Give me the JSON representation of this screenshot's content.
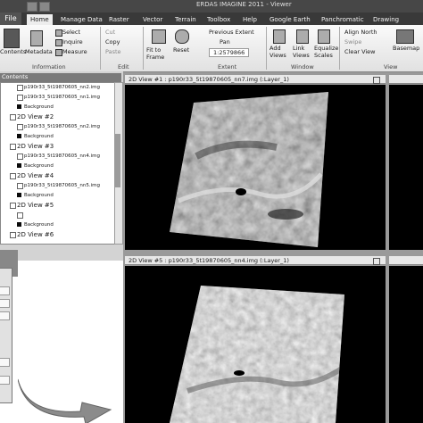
{
  "window": {
    "title": "ERDAS IMAGINE 2011 - Viewer"
  },
  "tabs": [
    "Home",
    "Manage Data",
    "Raster",
    "Vector",
    "Terrain",
    "Toolbox",
    "Help",
    "Google Earth",
    "Panchromatic",
    "Drawing"
  ],
  "file_tab": "File",
  "ribbon": {
    "contents": "Contents",
    "metadata": "Metadata",
    "select": "Select",
    "inquire": "Inquire",
    "measure": "Measure",
    "cut": "Cut",
    "copy": "Copy",
    "paste": "Paste",
    "fit_to_frame": "Fit to Frame",
    "reset": "Reset",
    "previous_extent": "Previous Extent",
    "pan": "Pan",
    "scale_value": "1:2579866",
    "add_views": "Add Views",
    "link_views": "Link Views",
    "equalize_scales": "Equalize Scales",
    "align_north": "Align North",
    "swipe": "Swipe",
    "clear_view": "Clear View",
    "basemap": "Basemap",
    "groups": {
      "information": "Information",
      "edit": "Edit",
      "extent": "Extent",
      "window": "Window",
      "view": "View"
    }
  },
  "contents_panel": {
    "title": "Contents",
    "items": [
      {
        "type": "layer",
        "label": "p190r33_5t19870605_nn2.img"
      },
      {
        "type": "layer",
        "label": "p190r33_5t19870605_nn1.img"
      },
      {
        "type": "bg",
        "label": "Background"
      },
      {
        "type": "view",
        "label": "2D View #2"
      },
      {
        "type": "layer",
        "label": "p190r33_5t19870605_nn2.img"
      },
      {
        "type": "bg",
        "label": "Background"
      },
      {
        "type": "view",
        "label": "2D View #3"
      },
      {
        "type": "layer",
        "label": "p190r33_5t19870605_nn4.img"
      },
      {
        "type": "bg",
        "label": "Background"
      },
      {
        "type": "view",
        "label": "2D View #4"
      },
      {
        "type": "layer",
        "label": "p190r33_5t19870605_nn5.img"
      },
      {
        "type": "bg",
        "label": "Background"
      },
      {
        "type": "view",
        "label": "2D View #5"
      },
      {
        "type": "layer",
        "label": "p190r33_5t19870605_nn4.img",
        "selected": true
      },
      {
        "type": "bg",
        "label": "Background"
      },
      {
        "type": "view",
        "label": "2D View #6"
      }
    ]
  },
  "views": {
    "top_title": "2D View #1 : p190r33_5t19870605_nn7.img (:Layer_1)",
    "bottom_title": "2D View #5 : p190r33_5t19870605_nn4.img (:Layer_1)"
  },
  "colors": {
    "tab_bar": "#3c3c3c",
    "ribbon": "#e6e6e6",
    "view_bg": "#000000",
    "accent_arrow": "#888888"
  }
}
